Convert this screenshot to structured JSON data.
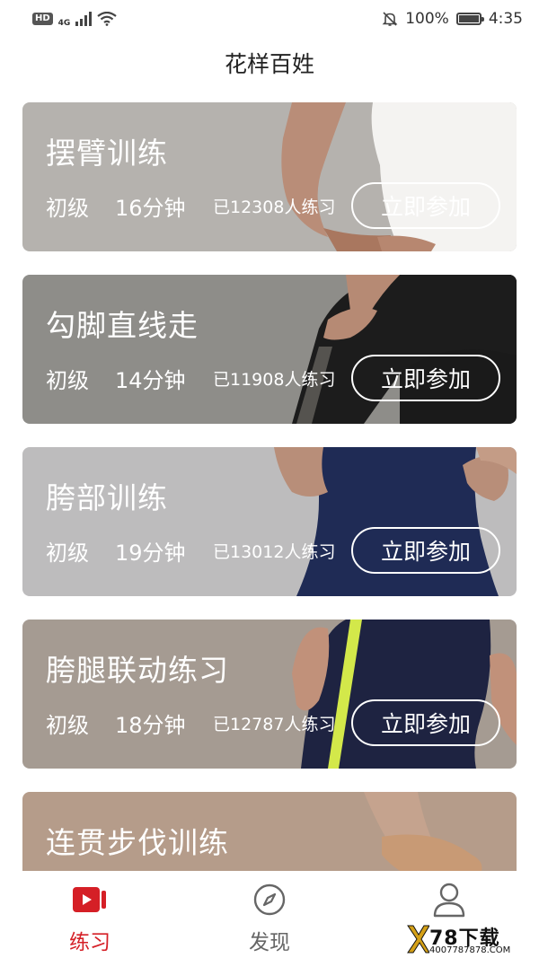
{
  "status_bar": {
    "hd": "HD",
    "network": "4G",
    "battery_percent": "100%",
    "time": "4:35"
  },
  "app_title": "花样百姓",
  "courses": [
    {
      "title": "摆臂训练",
      "level": "初级",
      "duration": "16分钟",
      "participants": "已12308人练习",
      "join_label": "立即参加"
    },
    {
      "title": "勾脚直线走",
      "level": "初级",
      "duration": "14分钟",
      "participants": "已11908人练习",
      "join_label": "立即参加"
    },
    {
      "title": "胯部训练",
      "level": "初级",
      "duration": "19分钟",
      "participants": "已13012人练习",
      "join_label": "立即参加"
    },
    {
      "title": "胯腿联动练习",
      "level": "初级",
      "duration": "18分钟",
      "participants": "已12787人练习",
      "join_label": "立即参加"
    },
    {
      "title": "连贯步伐训练",
      "level": "",
      "duration": "",
      "participants": "",
      "join_label": ""
    }
  ],
  "bottom_nav": {
    "items": [
      {
        "label": "练习",
        "icon": "video-play-icon",
        "active": true
      },
      {
        "label": "发现",
        "icon": "compass-icon",
        "active": false
      },
      {
        "label": "",
        "icon": "person-icon",
        "active": false
      }
    ]
  },
  "watermark": {
    "main": "78下载",
    "sub": "4007787878.COM"
  },
  "colors": {
    "accent_red": "#d51f26",
    "card1_bg": "#b5b2ae",
    "card2_bg": "#8e8d89",
    "card3_bg": "#bdbcbd",
    "card4_bg": "#a59b92",
    "card5_bg": "#b59c8a"
  }
}
